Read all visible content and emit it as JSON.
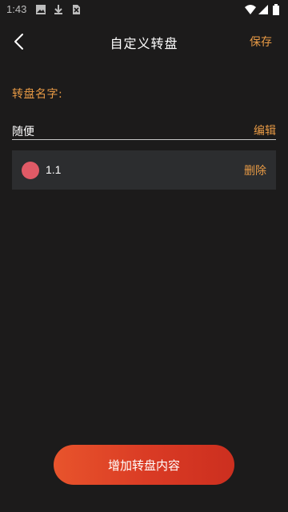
{
  "status_bar": {
    "time": "1:43",
    "icons": [
      "image-icon",
      "download-icon",
      "no-sim-icon",
      "wifi-icon",
      "signal-icon",
      "battery-icon"
    ]
  },
  "nav": {
    "title": "自定义转盘",
    "save_label": "保存",
    "back_icon": "chevron-left-icon"
  },
  "wheel": {
    "name_label": "转盘名字:",
    "name_value": "随便",
    "edit_label": "编辑"
  },
  "items": [
    {
      "label": "1.1",
      "color": "#e05a66",
      "delete_label": "删除"
    }
  ],
  "add_button_label": "增加转盘内容",
  "colors": {
    "background": "#1c1b1b",
    "accent": "#e89a45",
    "card": "#2c2d2f",
    "button_start": "#e8542c",
    "button_end": "#cc2f1f"
  }
}
